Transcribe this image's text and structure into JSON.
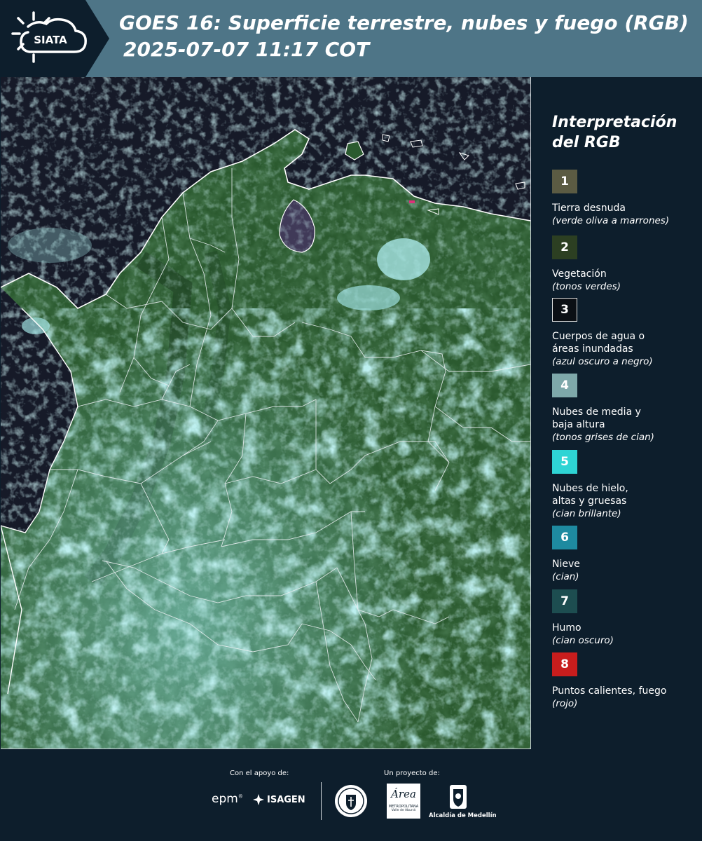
{
  "header": {
    "title_line1": "GOES 16: Superficie terrestre, nubes y fuego (RGB)",
    "title_line2": "2025-07-07 11:17 COT",
    "logo_text": "SIATA"
  },
  "legend": {
    "title_line1": "Interpretación",
    "title_line2": "del RGB",
    "items": [
      {
        "num": "1",
        "label": "Tierra desnuda",
        "desc": "(verde oliva a marrones)",
        "color": "#5b5b43"
      },
      {
        "num": "2",
        "label": "Vegetación",
        "desc": "(tonos verdes)",
        "color": "#2c3f22"
      },
      {
        "num": "3",
        "label": "Cuerpos de agua o áreas inundadas",
        "desc": "(azul oscuro a negro)",
        "color": "#0b0f14"
      },
      {
        "num": "4",
        "label": "Nubes de media y baja altura",
        "desc": "(tonos grises de cian)",
        "color": "#7ea8aa"
      },
      {
        "num": "5",
        "label": "Nubes de hielo, altas y gruesas",
        "desc": "(cian brillante)",
        "color": "#2ed4d4"
      },
      {
        "num": "6",
        "label": "Nieve",
        "desc": "(cian)",
        "color": "#1e8aa0"
      },
      {
        "num": "7",
        "label": "Humo",
        "desc": "(cian oscuro)",
        "color": "#1d4d50"
      },
      {
        "num": "8",
        "label": "Puntos calientes, fuego",
        "desc": "(rojo)",
        "color": "#c81d1d"
      }
    ]
  },
  "footer": {
    "support_label": "Con el apoyo de:",
    "project_label": "Un proyecto de:",
    "sponsor_epm": "epm",
    "sponsor_isagen": "ISAGEN",
    "logo_area_text": "Área",
    "logo_area_sub1": "METROPOLITANA",
    "logo_area_sub2": "Valle de Aburrá",
    "logo_alcaldia": "Alcaldía de Medellín"
  },
  "colors": {
    "background": "#0d1e2c",
    "header": "#4e7587",
    "land": "#2c5a2c",
    "ocean": "#131624",
    "cloud": "#7ed8d8"
  }
}
